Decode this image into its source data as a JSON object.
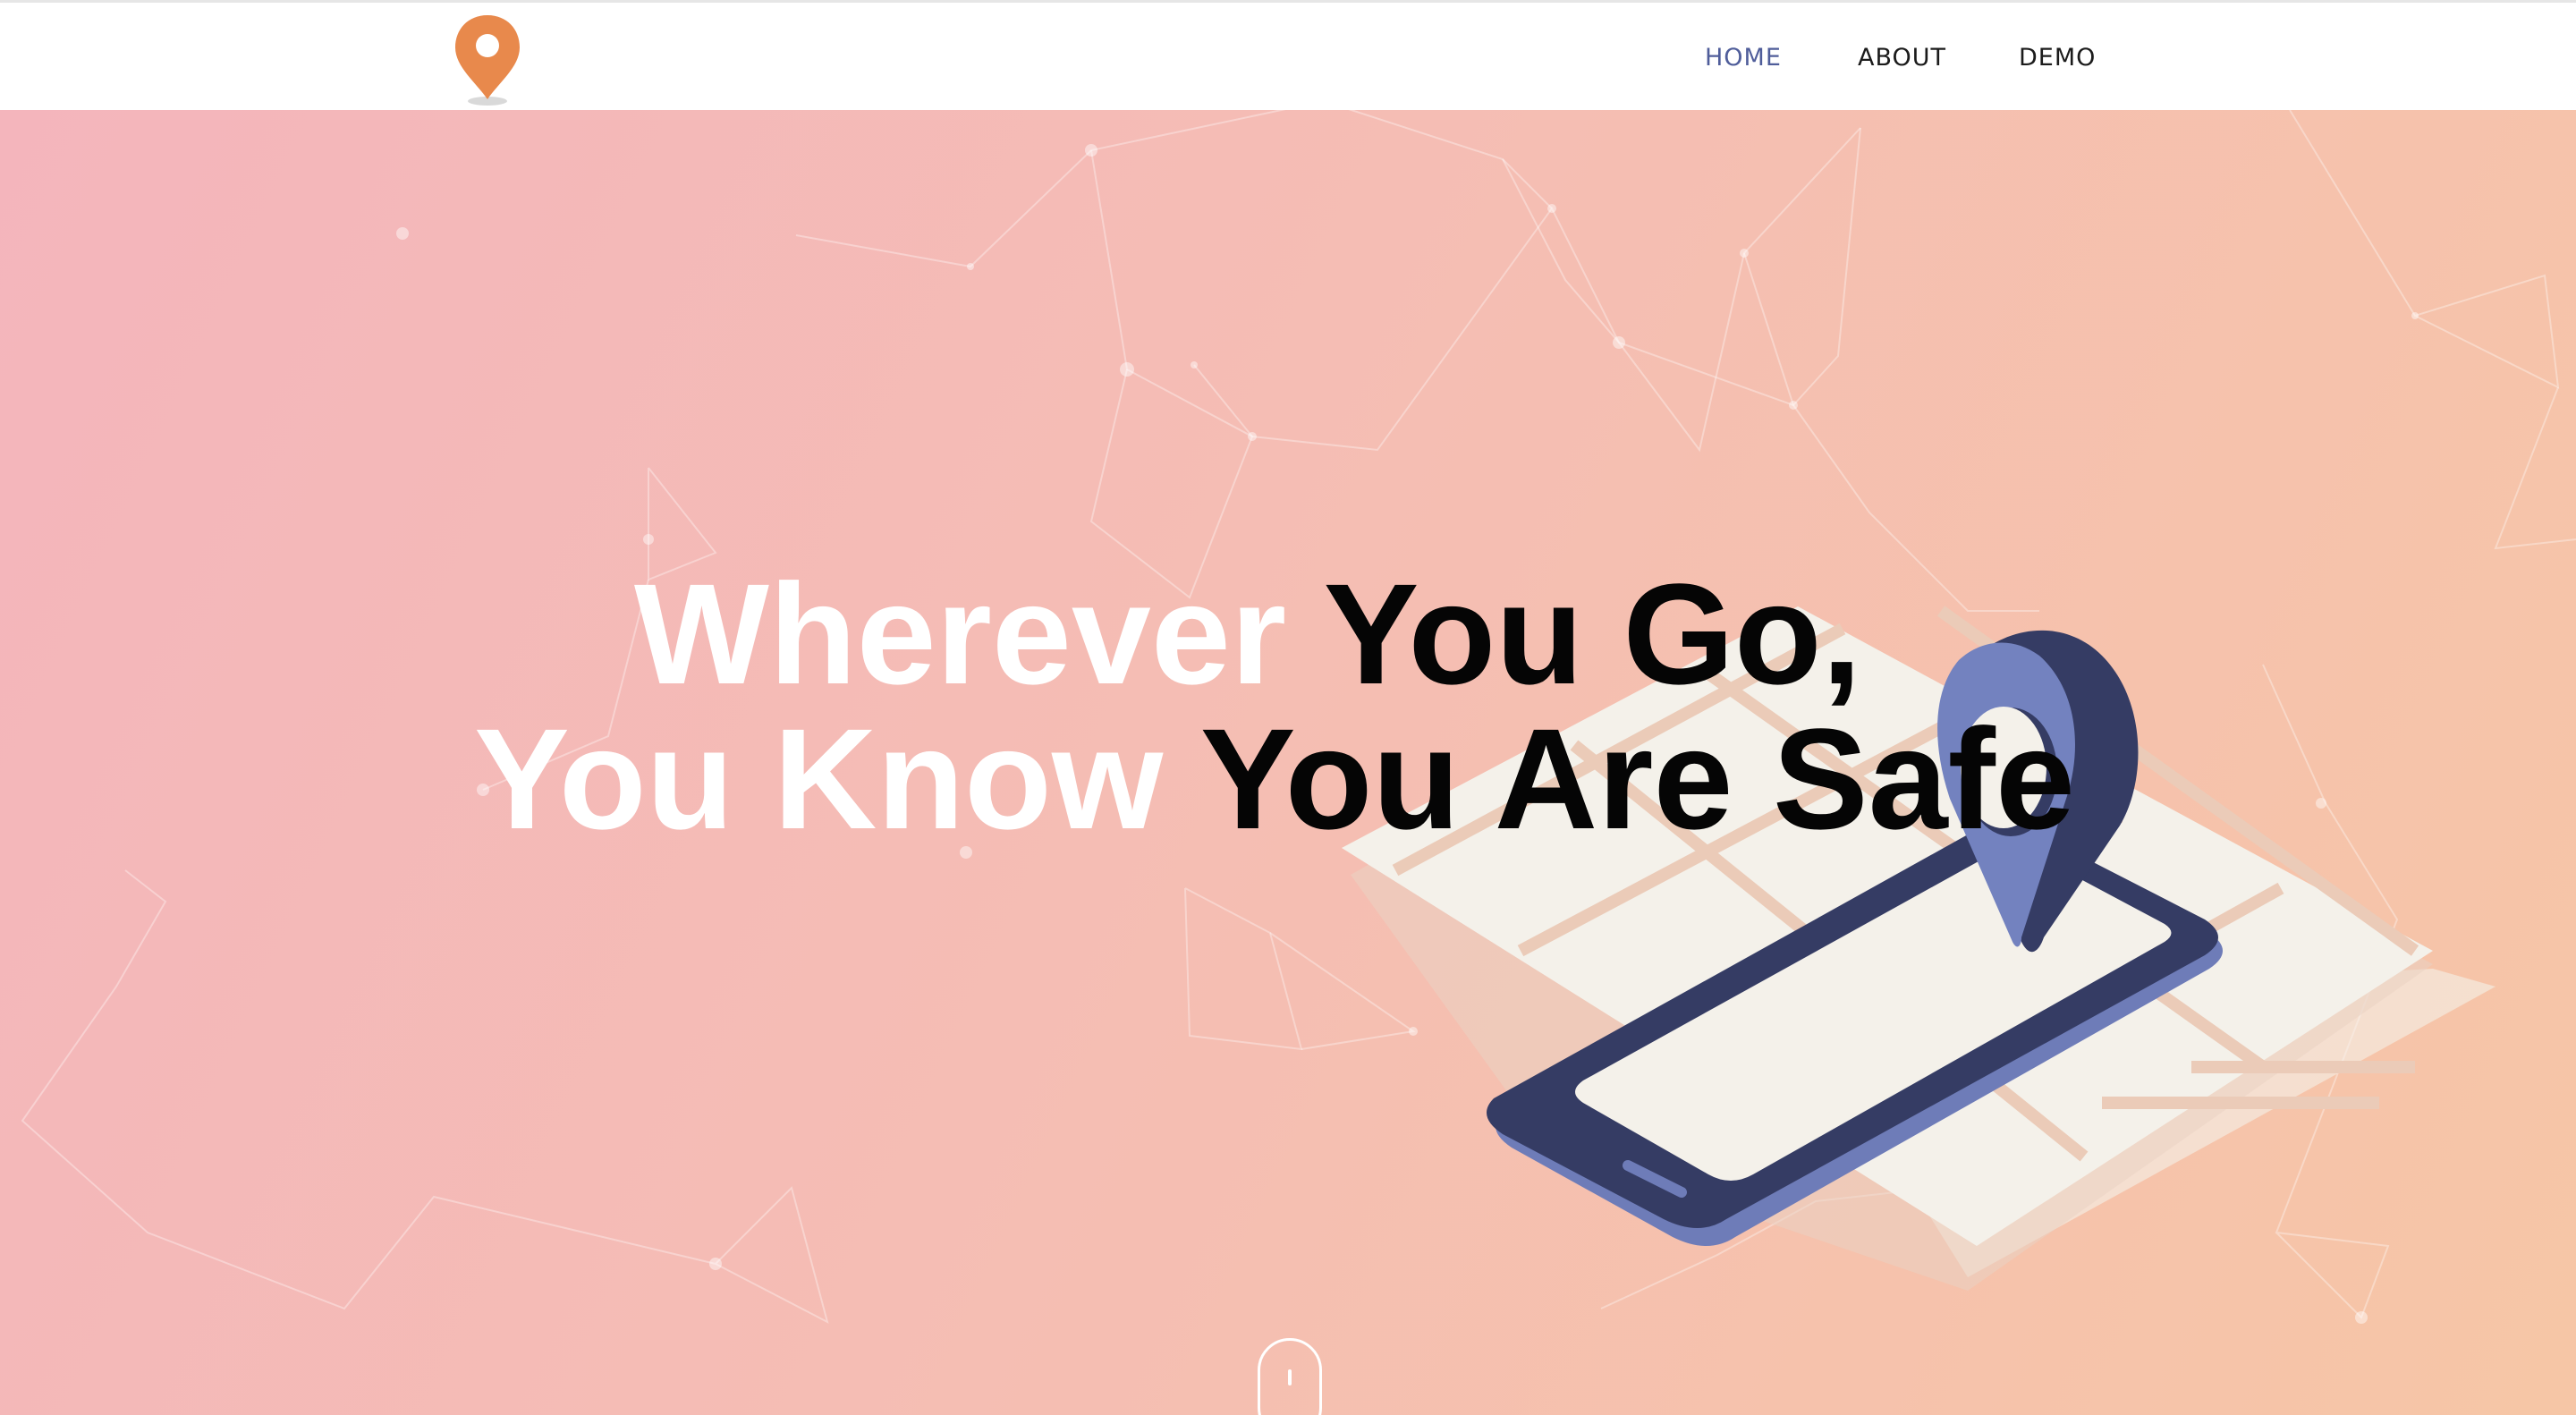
{
  "nav": {
    "items": [
      {
        "label": "HOME",
        "active": true
      },
      {
        "label": "ABOUT",
        "active": false
      },
      {
        "label": "DEMO",
        "active": false
      }
    ]
  },
  "hero": {
    "headline_line1_white": "Wherever ",
    "headline_line1_black": "You Go,",
    "headline_line2_white": "You Know ",
    "headline_line2_black": "You Are Safe"
  },
  "colors": {
    "logo_pin": "#e8894c",
    "nav_active": "#4f5d9a",
    "hero_gradient_start": "#f4b5bc",
    "hero_gradient_end": "#f6c6a6",
    "phone_body": "#353c64",
    "pin_blue": "#7382bf"
  },
  "icons": {
    "logo": "map-pin-logo-icon",
    "scroll": "mouse-scroll-icon",
    "illustration": "phone-map-pin-illustration"
  }
}
